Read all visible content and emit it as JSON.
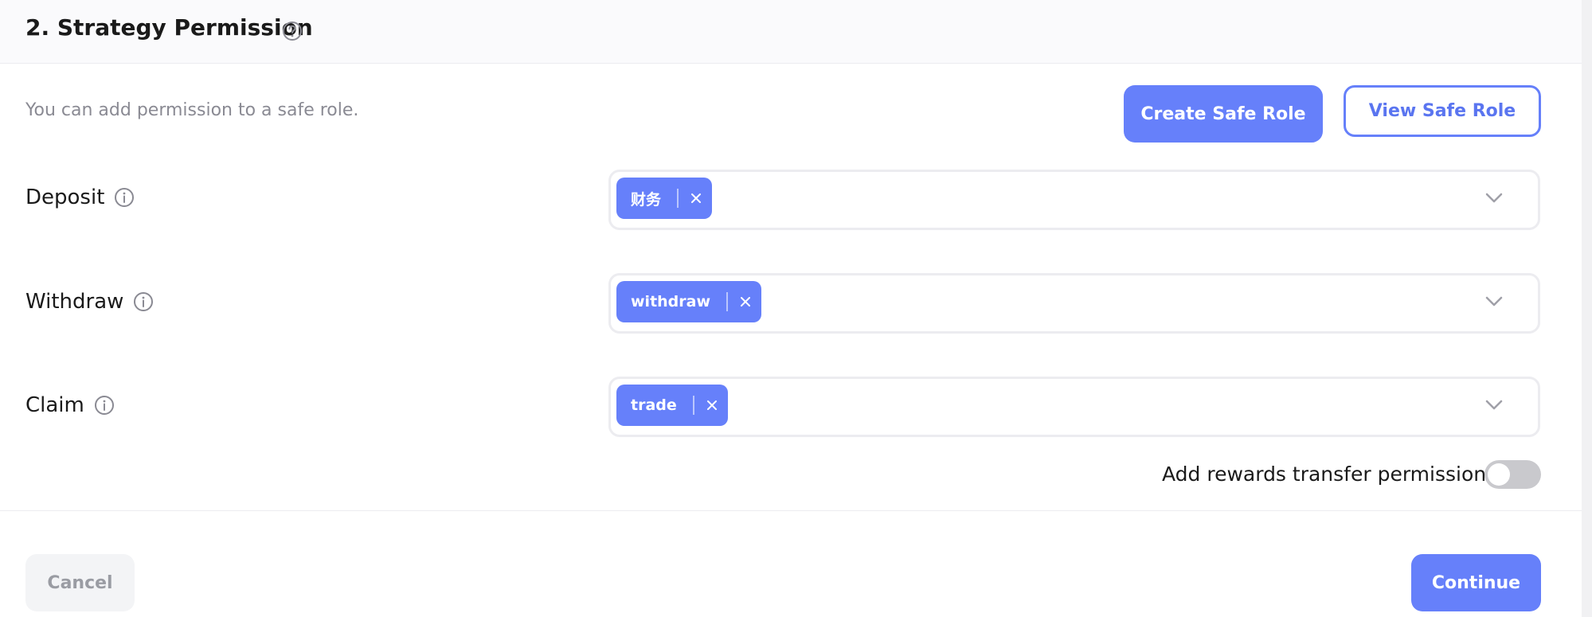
{
  "header": {
    "title": "2. Strategy Permission",
    "help_icon": "question-circle-icon"
  },
  "hint": "You can add permission to a safe role.",
  "actions": {
    "create_label": "Create Safe Role",
    "view_label": "View Safe Role"
  },
  "permissions": [
    {
      "label": "Deposit",
      "tags": [
        "财务"
      ]
    },
    {
      "label": "Withdraw",
      "tags": [
        "withdraw"
      ]
    },
    {
      "label": "Claim",
      "tags": [
        "trade"
      ]
    }
  ],
  "rewards_toggle": {
    "label": "Add rewards transfer permission",
    "enabled": false
  },
  "footer": {
    "cancel_label": "Cancel",
    "continue_label": "Continue"
  },
  "colors": {
    "accent": "#6680fa",
    "toggle_off": "#c9c9cd",
    "muted_text": "#8a8a93"
  }
}
